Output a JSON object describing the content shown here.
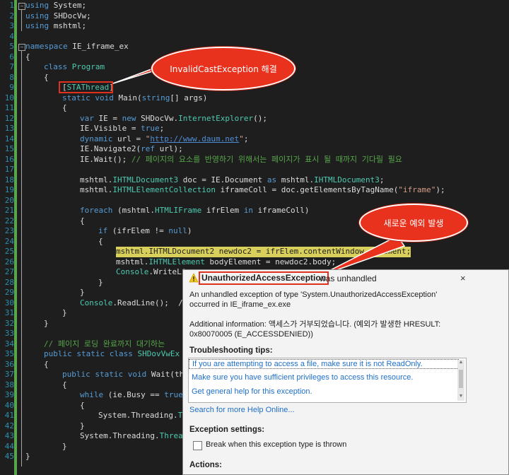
{
  "line_numbers": [
    "1",
    "2",
    "3",
    "4",
    "5",
    "6",
    "7",
    "8",
    "9",
    "10",
    "11",
    "12",
    "13",
    "14",
    "15",
    "16",
    "17",
    "18",
    "19",
    "20",
    "21",
    "22",
    "23",
    "24",
    "25",
    "26",
    "27",
    "28",
    "29",
    "30",
    "31",
    "32",
    "33",
    "34",
    "35",
    "36",
    "37",
    "38",
    "39",
    "40",
    "41",
    "42",
    "43",
    "44",
    "45"
  ],
  "code_tokens": {
    "l1": [
      "using",
      " System;"
    ],
    "l2": [
      "using",
      " SHDocVw;"
    ],
    "l3": [
      "using",
      " mshtml;"
    ],
    "l5": [
      "namespace",
      " IE_iframe_ex"
    ],
    "l6": [
      "{"
    ],
    "l7": [
      "class",
      " ",
      "Program"
    ],
    "l8": [
      "{"
    ],
    "l9": [
      "[",
      "STAThread",
      "]"
    ],
    "l10": [
      "static",
      " ",
      "void",
      " Main(",
      "string",
      "[] args)"
    ],
    "l11": [
      "{"
    ],
    "l12": [
      "var",
      " IE = ",
      "new",
      " SHDocVw.",
      "InternetExplorer",
      "();"
    ],
    "l13": [
      "IE.Visible = ",
      "true",
      ";"
    ],
    "l14": [
      "dynamic",
      " url = ",
      "\"",
      "http://www.daum.net",
      "\"",
      ";"
    ],
    "l15": [
      "IE.Navigate2(",
      "ref",
      " url);"
    ],
    "l16": [
      "IE.Wait(); ",
      "// 페이지의 요소를 반영하기 위해서는 페이지가 표시 될 때까지 기다릴 필요"
    ],
    "l18": [
      "mshtml.",
      "IHTMLDocument3",
      " doc = IE.Document ",
      "as",
      " mshtml.",
      "IHTMLDocument3",
      ";"
    ],
    "l19": [
      "mshtml.",
      "IHTMLElementCollection",
      " iframeColl = doc.getElementsByTagName(",
      "\"iframe\"",
      ");"
    ],
    "l21": [
      "foreach",
      " (mshtml.",
      "HTMLIFrame",
      " ifrElem ",
      "in",
      " iframeColl)"
    ],
    "l22": [
      "{"
    ],
    "l23": [
      "if",
      " (ifrElem != ",
      "null",
      ")"
    ],
    "l24": [
      "{"
    ],
    "l25": [
      "mshtml.",
      "IHTMLDocument2",
      " newdoc2 = ifrElem.contentWindow.document;"
    ],
    "l26": [
      "mshtml.",
      "IHTMLElement",
      " bodyElement = newdoc2.body;"
    ],
    "l27": [
      "Console",
      ".WriteLi"
    ],
    "l28": [
      "}"
    ],
    "l29": [
      "}"
    ],
    "l30": [
      "Console",
      ".ReadLine();  //"
    ],
    "l31": [
      "}"
    ],
    "l32": [
      "}"
    ],
    "l34": [
      "// 페이지 로딩 완료까지 대기하는"
    ],
    "l35": [
      "public",
      " ",
      "static",
      " ",
      "class",
      " ",
      "SHDovVwEx"
    ],
    "l36": [
      "{"
    ],
    "l37": [
      "public",
      " ",
      "static",
      " ",
      "void",
      " Wait(thi"
    ],
    "l38": [
      "{"
    ],
    "l39": [
      "while",
      " (ie.Busy == ",
      "true"
    ],
    "l40": [
      "{"
    ],
    "l41": [
      "System.Threading.",
      "Th"
    ],
    "l42": [
      "}"
    ],
    "l43": [
      "System.Threading.",
      "Thread"
    ],
    "l44": [
      "}"
    ],
    "l45": [
      "}"
    ]
  },
  "annotations": {
    "bubble1": "InvalidCastException 해결",
    "bubble2": "새로운 예외 발생"
  },
  "dialog": {
    "title_exception": "UnauthorizedAccessException",
    "title_rest": "was unhandled",
    "close": "×",
    "message1": "An unhandled exception of type 'System.UnauthorizedAccessException'",
    "message2": "occurred in IE_iframe_ex.exe",
    "info1": "Additional information: 액세스가 거부되었습니다. (예외가 발생한 HRESULT:",
    "info2": "0x80070005 (E_ACCESSDENIED))",
    "tips_heading": "Troubleshooting tips:",
    "tips": [
      "If you are attempting to access a file, make sure it is not ReadOnly.",
      "Make sure you have sufficient privileges to access this resource.",
      "Get general help for this exception."
    ],
    "search_link": "Search for more Help Online...",
    "settings_heading": "Exception settings:",
    "break_label": "Break when this exception type is thrown",
    "break_checked": false,
    "actions_heading": "Actions:"
  },
  "colors": {
    "editor_bg": "#1e1e1e",
    "keyword": "#569cd6",
    "type": "#4ec9b0",
    "string": "#d69d85",
    "comment": "#57a64a",
    "highlight": "#d8d05a",
    "annotation_red": "#e8321e",
    "link": "#1e6fc8"
  }
}
